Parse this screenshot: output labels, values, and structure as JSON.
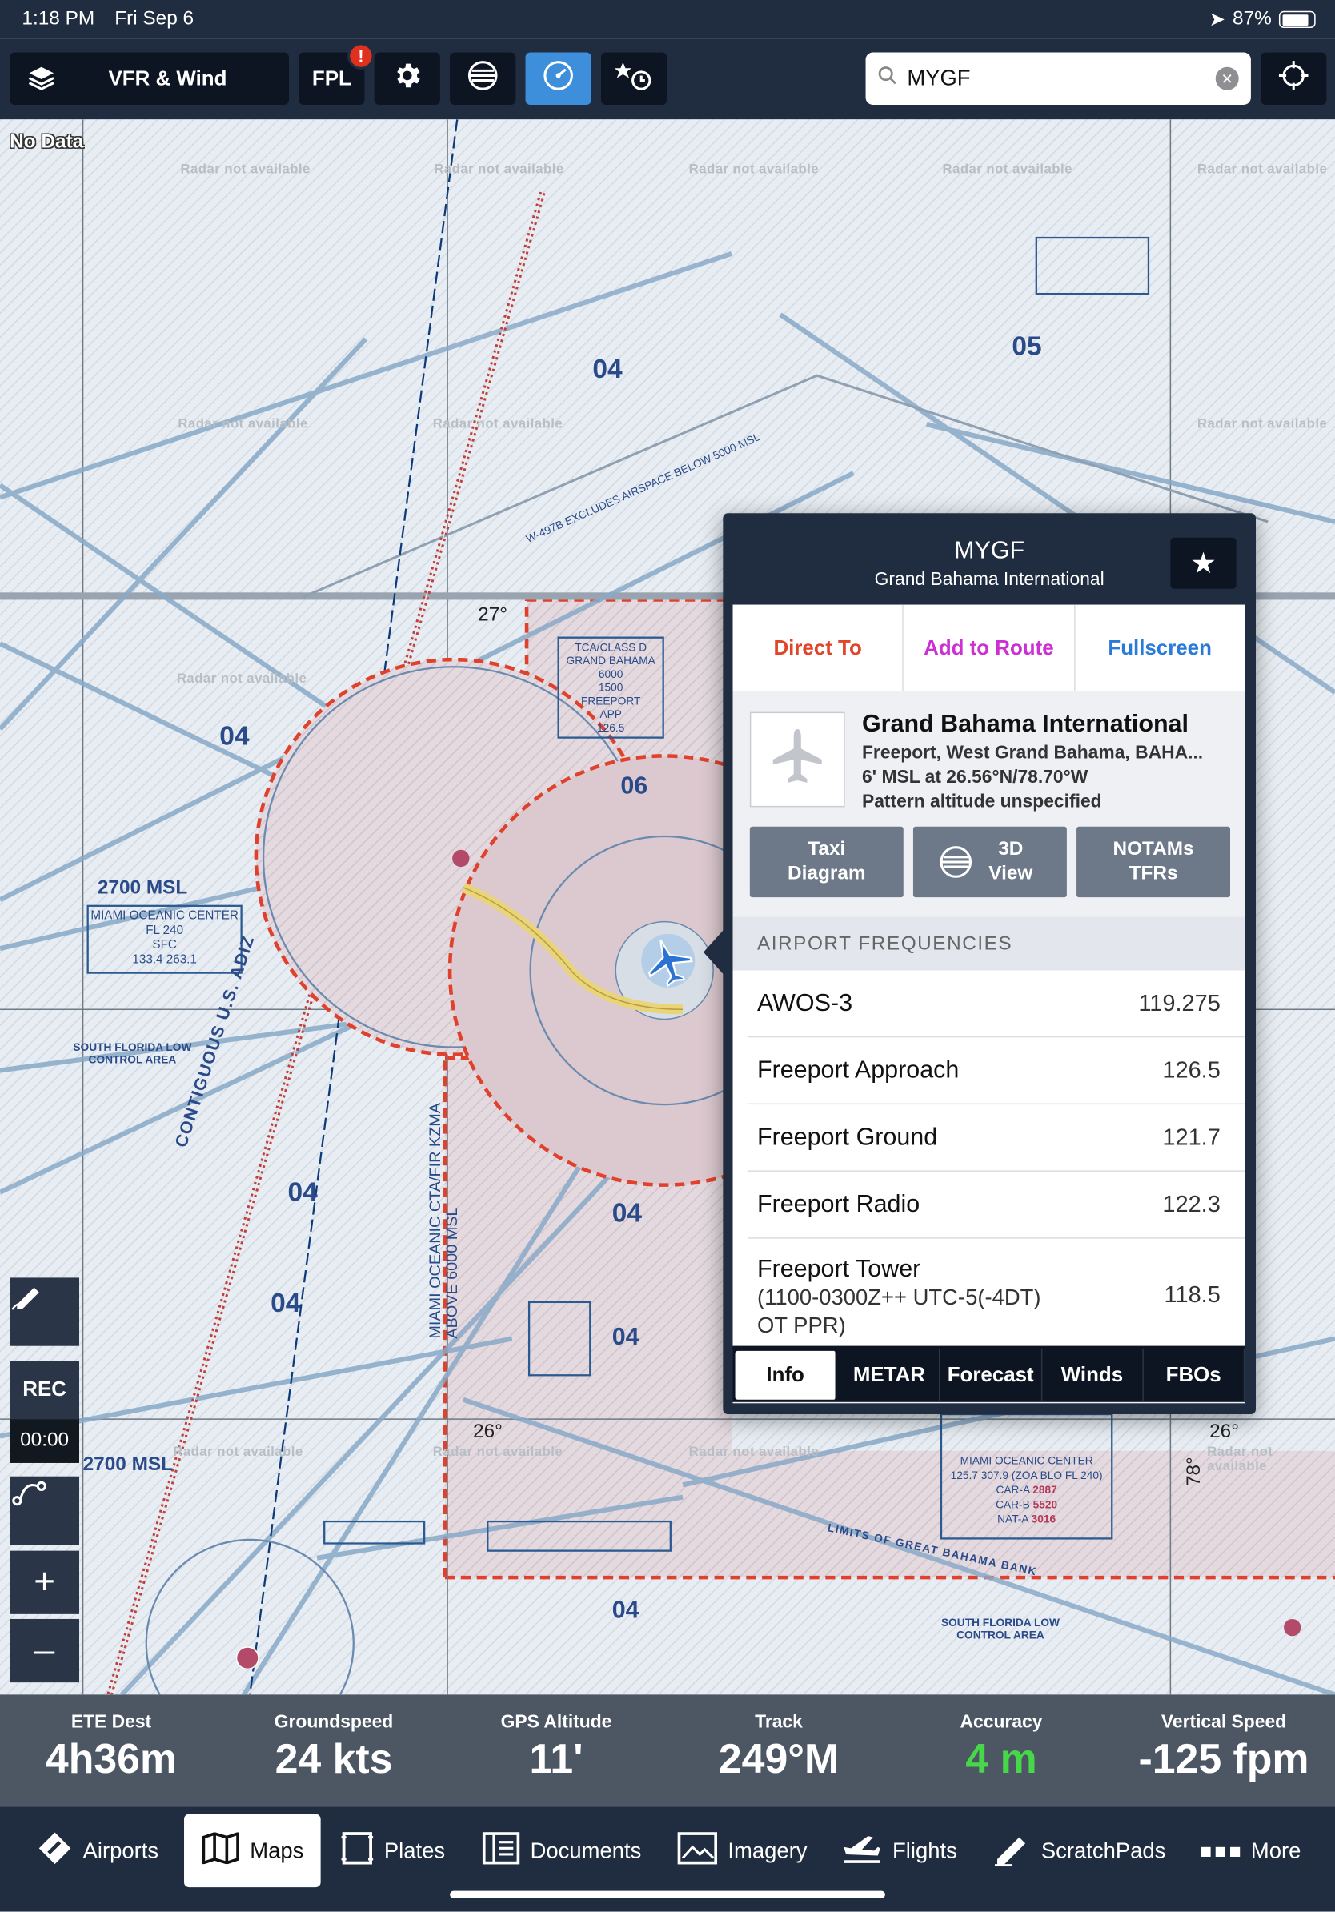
{
  "status": {
    "time": "1:18 PM",
    "date": "Fri Sep 6",
    "battery": "87%"
  },
  "toolbar": {
    "layers_label": "VFR & Wind",
    "fpl_label": "FPL",
    "fpl_badge": "!",
    "search_value": "MYGF"
  },
  "map": {
    "nodata_label": "No Data",
    "radar_na": "Radar not available",
    "labels": {
      "alt1": "2700 MSL",
      "alt2": "2700 MSL",
      "center1": "MIAMI OCEANIC CENTER",
      "center1_b": "FL 240",
      "center1_c": "SFC",
      "center1_d": "133.4 263.1",
      "low1": "SOUTH FLORIDA LOW",
      "low1_b": "CONTROL AREA",
      "adiz": "CONTIGUOUS U.S. ADIZ",
      "w497": "W-497B EXCLUDES AIRSPACE BELOW 5000 MSL",
      "n04a": "04",
      "n04b": "04",
      "n04c": "04",
      "n04d": "04",
      "n04e": "04",
      "n04f": "04",
      "n04g": "04",
      "n05": "05",
      "n06": "06",
      "lat27": "27°",
      "lat26a": "26°",
      "lat26b": "26°",
      "lon78": "78°",
      "tca_a": "TCA/CLASS D",
      "tca_b": "GRAND BAHAMA",
      "tca_c": "6000",
      "tca_d": "1500",
      "tca_e": "FREEPORT",
      "tca_f": "APP",
      "tca_g": "126.5",
      "cta_vert": "MIAMI OCEANIC CTA/FIR KZMA",
      "cta_vert_b": "ABOVE 6000 MSL",
      "mcc_a": "MIAMI OCEANIC CENTER",
      "mcc_b": "125.7 307.9 (ZOA BLO FL 240)",
      "mcc_c": "CAR-A",
      "mcc_c2": "2887",
      "mcc_d": "CAR-B",
      "mcc_d2": "5520",
      "mcc_e": "NAT-A",
      "mcc_e2": "3016",
      "limits": "LIMITS OF GREAT BAHAMA BANK",
      "low2": "SOUTH FLORIDA LOW",
      "low2_b": "CONTROL AREA"
    }
  },
  "controls": {
    "rec_label": "REC",
    "rec_time": "00:00"
  },
  "popup": {
    "id": "MYGF",
    "name": "Grand Bahama International",
    "actions": {
      "direct_to": "Direct To",
      "add_to_route": "Add to Route",
      "fullscreen": "Fullscreen"
    },
    "airport": {
      "name": "Grand Bahama International",
      "location": "Freeport, West Grand Bahama, BAHA...",
      "elevation": "6' MSL at 26.56°N/78.70°W",
      "pattern": "Pattern altitude unspecified"
    },
    "buttons": {
      "taxi": "Taxi",
      "taxi2": "Diagram",
      "view3d": "3D",
      "view3d2": "View",
      "notams": "NOTAMs",
      "notams2": "TFRs"
    },
    "freq_header": "AIRPORT FREQUENCIES",
    "frequencies": [
      {
        "name": "AWOS-3",
        "value": "119.275"
      },
      {
        "name": "Freeport Approach",
        "value": "126.5"
      },
      {
        "name": "Freeport Ground",
        "value": "121.7"
      },
      {
        "name": "Freeport Radio",
        "value": "122.3"
      },
      {
        "name": "Freeport Tower",
        "value": "118.5",
        "sub1": "(1100-0300Z++ UTC-5(-4DT)",
        "sub2": "OT PPR)"
      }
    ],
    "tabs": [
      "Info",
      "METAR",
      "Forecast",
      "Winds",
      "FBOs"
    ]
  },
  "instruments": [
    {
      "label": "ETE Dest",
      "value": "4h36m"
    },
    {
      "label": "Groundspeed",
      "value": "24 kts"
    },
    {
      "label": "GPS Altitude",
      "value": "11'"
    },
    {
      "label": "Track",
      "value": "249°M"
    },
    {
      "label": "Accuracy",
      "value": "4 m"
    },
    {
      "label": "Vertical Speed",
      "value": "-125 fpm"
    }
  ],
  "accuracy_color": "#47d84a",
  "tabbar": [
    "Airports",
    "Maps",
    "Plates",
    "Documents",
    "Imagery",
    "Flights",
    "ScratchPads",
    "More"
  ]
}
